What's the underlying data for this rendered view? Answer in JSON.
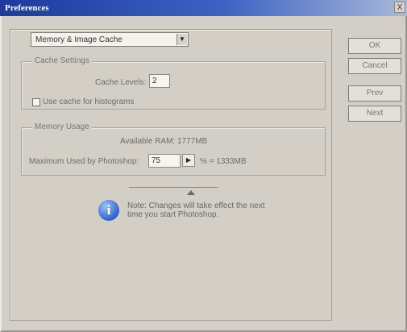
{
  "window": {
    "title": "Preferences",
    "close_label": "X"
  },
  "section_select": {
    "value": "Memory & Image Cache"
  },
  "cache_settings": {
    "legend": "Cache Settings",
    "cache_levels_label": "Cache Levels:",
    "cache_levels_value": "2",
    "use_cache_histograms_label": "Use cache for histograms",
    "use_cache_histograms_checked": false
  },
  "memory_usage": {
    "legend": "Memory Usage",
    "available_ram": "Available RAM: 1777MB",
    "max_used_label": "Maximum Used by Photoshop:",
    "max_used_value": "75",
    "max_used_suffix": "% = 1333MB",
    "slider_percent": 75
  },
  "note": {
    "text": "Note: Changes will take effect the next time you start Photoshop."
  },
  "buttons": {
    "ok": "OK",
    "cancel": "Cancel",
    "prev": "Prev",
    "next": "Next"
  }
}
